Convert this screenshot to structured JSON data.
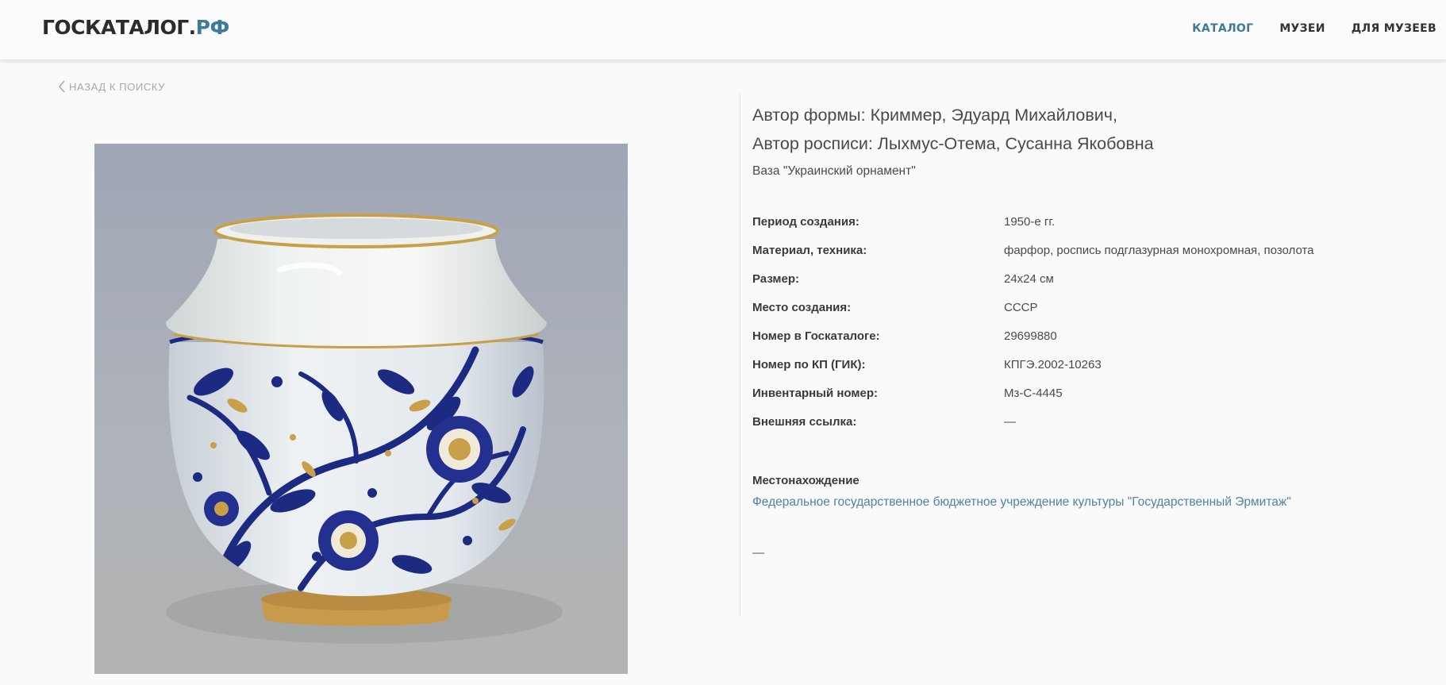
{
  "header": {
    "logo_main": "ГОСКАТАЛОГ.",
    "logo_suffix": "РФ",
    "nav": [
      {
        "label": "КАТАЛОГ",
        "active": true
      },
      {
        "label": "МУЗЕИ",
        "active": false
      },
      {
        "label": "ДЛЯ МУЗЕЕВ",
        "active": false
      }
    ]
  },
  "back_link": {
    "label": "НАЗАД К ПОИСКУ",
    "icon": "chevron-left-icon"
  },
  "object": {
    "form_author": "Автор формы: Криммер, Эдуард Михайлович,",
    "painting_author": "Автор росписи: Лыхмус-Отема, Сусанна Якобовна",
    "title": "Ваза \"Украинский орнамент\"",
    "image_subject": "vase-photo"
  },
  "attributes": [
    {
      "label": "Период создания:",
      "value": "1950-е гг."
    },
    {
      "label": "Материал, техника:",
      "value": "фарфор, роспись подглазурная монохромная, позолота"
    },
    {
      "label": "Размер:",
      "value": "24x24 см"
    },
    {
      "label": "Место создания:",
      "value": "СССР"
    },
    {
      "label": "Номер в Госкаталоге:",
      "value": "29699880"
    },
    {
      "label": "Номер по КП (ГИК):",
      "value": "КПГЭ.2002-10263"
    },
    {
      "label": "Инвентарный номер:",
      "value": "Мз-С-4445"
    },
    {
      "label": "Внешняя ссылка:",
      "value": "—"
    }
  ],
  "location": {
    "heading": "Местонахождение",
    "museum": "Федеральное государственное бюджетное учреждение культуры \"Государственный Эрмитаж\""
  },
  "footer_dash": "—",
  "colors": {
    "accent": "#3d7a9a",
    "link": "#4d84a3",
    "cobalt": "#1d2a82",
    "gold": "#c9a049"
  }
}
